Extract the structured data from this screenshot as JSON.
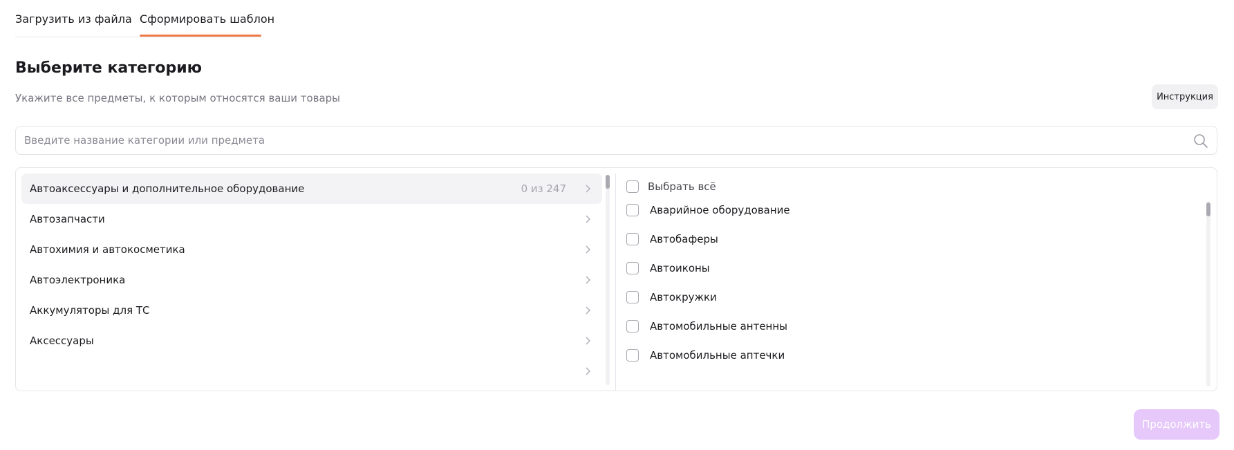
{
  "tabs": {
    "upload": "Загрузить из файла",
    "template": "Сформировать шаблон",
    "active": "template"
  },
  "header": {
    "title": "Выберите категорию",
    "subtitle": "Укажите все предметы, к которым относятся ваши товары",
    "instruction_label": "Инструкция"
  },
  "search": {
    "placeholder": "Введите название категории или предмета",
    "value": ""
  },
  "categories": [
    {
      "label": "Автоаксессуары и дополнительное оборудование",
      "count": "0 из 247",
      "active": true
    },
    {
      "label": "Автозапчасти"
    },
    {
      "label": "Автохимия и автокосметика"
    },
    {
      "label": "Автоэлектроника"
    },
    {
      "label": "Аккумуляторы для ТС"
    },
    {
      "label": "Аксессуары"
    }
  ],
  "subjects": {
    "select_all_label": "Выбрать всё",
    "items": [
      {
        "label": "Аварийное оборудование",
        "checked": false
      },
      {
        "label": "Автобаферы",
        "checked": false
      },
      {
        "label": "Автоиконы",
        "checked": false
      },
      {
        "label": "Автокружки",
        "checked": false
      },
      {
        "label": "Автомобильные антенны",
        "checked": false
      },
      {
        "label": "Автомобильные аптечки",
        "checked": false
      }
    ]
  },
  "footer": {
    "continue_label": "Продолжить"
  },
  "colors": {
    "accent_underline": "#ee7a46",
    "continue_disabled_bg": "#e6c8fb",
    "active_row_bg": "#f3f3f5"
  }
}
